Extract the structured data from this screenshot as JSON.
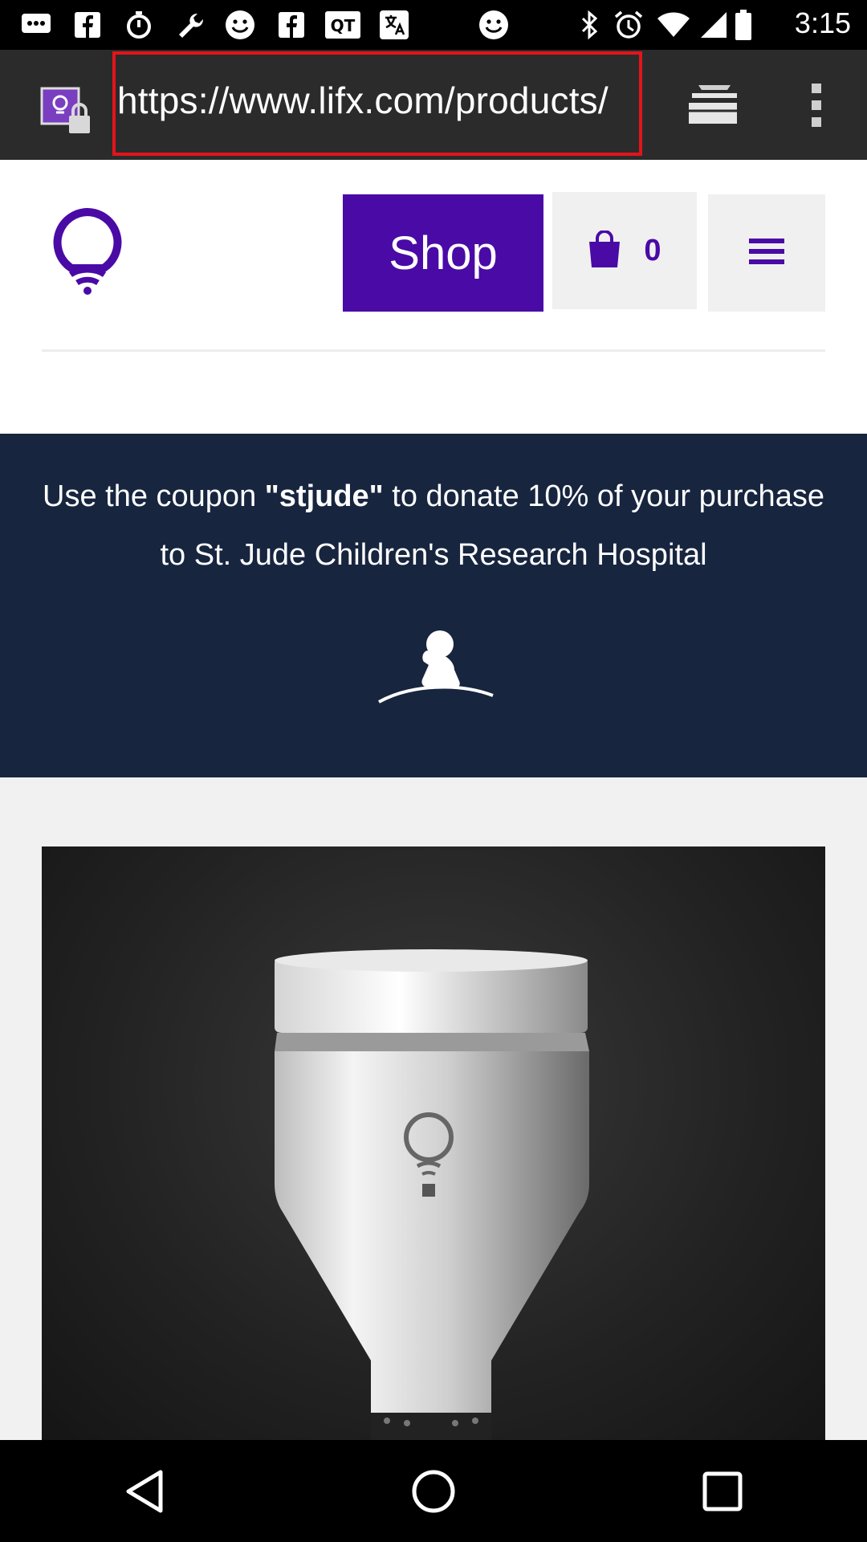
{
  "status_bar": {
    "time": "3:15",
    "icons": [
      "messages-icon",
      "facebook-icon",
      "timer-icon",
      "wrench-icon",
      "smiley-icon",
      "facebook-icon",
      "qt-icon",
      "translate-icon",
      "smiley-icon",
      "bluetooth-icon",
      "alarm-icon",
      "wifi-icon",
      "signal-icon",
      "battery-icon"
    ]
  },
  "browser": {
    "url": "https://www.lifx.com/products/",
    "icons": [
      "site-favicon-lock-icon",
      "tabs-icon",
      "overflow-menu-icon"
    ]
  },
  "header": {
    "shop_label": "Shop",
    "cart_count": "0",
    "brand_color": "#4a0aa6"
  },
  "banner": {
    "text_before": "Use the coupon ",
    "coupon": "\"stjude\"",
    "text_after": " to donate 10% of your purchase to St. Jude Children's Research Hospital",
    "background_color": "#17253f",
    "logo": "st-jude-child-logo-icon"
  },
  "product": {
    "image": "lifx-bulb-product-image"
  },
  "nav_bar": {
    "icons": [
      "back-icon",
      "home-icon",
      "recents-icon"
    ]
  }
}
